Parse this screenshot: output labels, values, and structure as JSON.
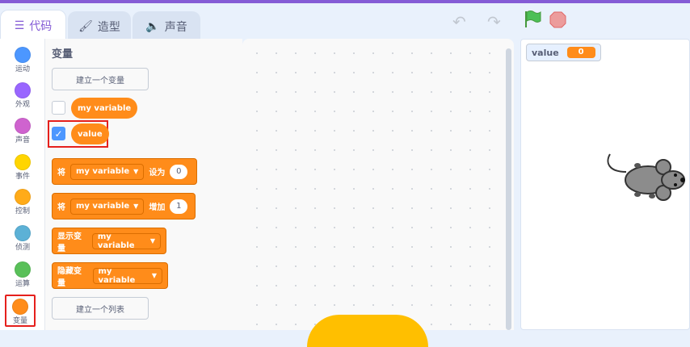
{
  "tabs": [
    {
      "label": "代码",
      "icon": "code-icon",
      "active": true
    },
    {
      "label": "造型",
      "icon": "brush-icon",
      "active": false
    },
    {
      "label": "声音",
      "icon": "speaker-icon",
      "active": false
    }
  ],
  "categories": [
    {
      "label": "运动",
      "color": "#4c97ff"
    },
    {
      "label": "外观",
      "color": "#9966ff"
    },
    {
      "label": "声音",
      "color": "#cf63cf"
    },
    {
      "label": "事件",
      "color": "#ffd500"
    },
    {
      "label": "控制",
      "color": "#ffab19"
    },
    {
      "label": "侦测",
      "color": "#5cb1d6"
    },
    {
      "label": "运算",
      "color": "#59c059"
    },
    {
      "label": "变量",
      "color": "#ff8c1a"
    }
  ],
  "palette": {
    "title": "变量",
    "make_variable": "建立一个变量",
    "make_list": "建立一个列表",
    "variables": [
      {
        "name": "my variable",
        "checked": false
      },
      {
        "name": "value",
        "checked": true
      }
    ],
    "blocks": [
      {
        "prefix": "将",
        "dropdown": "my variable",
        "mid": "设为",
        "input": "0"
      },
      {
        "prefix": "将",
        "dropdown": "my variable",
        "mid": "增加",
        "input": "1"
      },
      {
        "prefix": "显示变量",
        "dropdown": "my variable"
      },
      {
        "prefix": "隐藏变量",
        "dropdown": "my variable"
      }
    ]
  },
  "stage": {
    "monitor": {
      "label": "value",
      "value": "0"
    }
  }
}
